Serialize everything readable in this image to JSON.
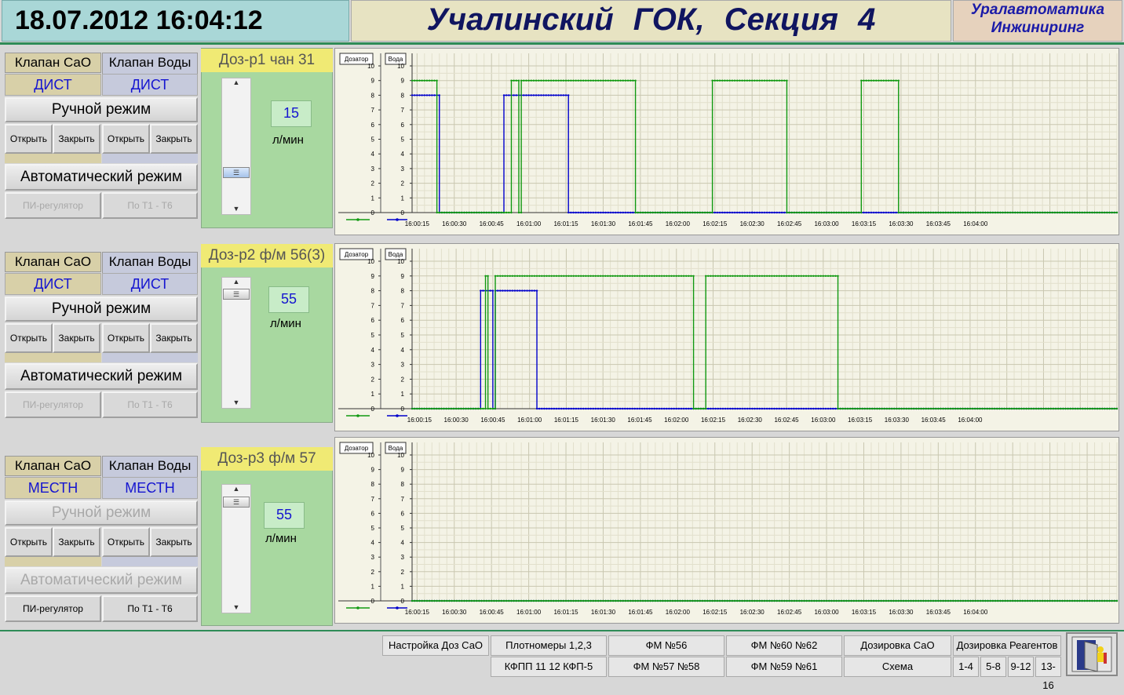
{
  "header": {
    "datetime": "18.07.2012 16:04:12",
    "title": "Учалинский ГОК,    Секция 4",
    "brand_line1": "Уралавтоматика",
    "brand_line2": "Инжиниринг"
  },
  "sections": [
    {
      "cao_label": "Клапан СаО",
      "vod_label": "Клапан Воды",
      "cao_mode": "ДИСТ",
      "vod_mode": "ДИСТ",
      "manual": "Ручной режим",
      "auto": "Автоматический режим",
      "open_cao": "Открыть",
      "close_cao": "Закрыть",
      "open_vod": "Открыть",
      "close_vod": "Закрыть",
      "pi": "ПИ-регулятор",
      "t1t6": "По Т1 - Т6",
      "doser_title": "Доз-р1 чан 31",
      "value": "15",
      "unit": "л/мин",
      "manual_enabled": true,
      "auto_enabled": true,
      "bottom_enabled": false
    },
    {
      "cao_label": "Клапан СаО",
      "vod_label": "Клапан Воды",
      "cao_mode": "ДИСТ",
      "vod_mode": "ДИСТ",
      "manual": "Ручной режим",
      "auto": "Автоматический режим",
      "open_cao": "Открыть",
      "close_cao": "Закрыть",
      "open_vod": "Открыть",
      "close_vod": "Закрыть",
      "pi": "ПИ-регулятор",
      "t1t6": "По Т1 - Т6",
      "doser_title": "Доз-р2  ф/м 56(3)",
      "value": "55",
      "unit": "л/мин",
      "manual_enabled": true,
      "auto_enabled": true,
      "bottom_enabled": false
    },
    {
      "cao_label": "Клапан СаО",
      "vod_label": "Клапан Воды",
      "cao_mode": "МЕСТН",
      "vod_mode": "МЕСТН",
      "manual": "Ручной режим",
      "auto": "Автоматический режим",
      "open_cao": "Открыть",
      "close_cao": "Закрыть",
      "open_vod": "Открыть",
      "close_vod": "Закрыть",
      "pi": "ПИ-регулятор",
      "t1t6": "По Т1 - Т6",
      "doser_title": "Доз-р3 ф/м 57",
      "value": "55",
      "unit": "л/мин",
      "manual_enabled": false,
      "auto_enabled": false,
      "bottom_enabled": true
    }
  ],
  "chart_data": [
    {
      "type": "line",
      "axis_tag_left": "Дозатор",
      "axis_tag_right": "Вода",
      "ylim": [
        0,
        10
      ],
      "yticks": [
        0,
        1,
        2,
        3,
        4,
        5,
        6,
        7,
        8,
        9,
        10
      ],
      "xlim_sec": [
        13,
        297
      ],
      "x_tick_labels": [
        "16:00:15",
        "16:00:30",
        "16:00:45",
        "16:01:00",
        "16:01:15",
        "16:01:30",
        "16:01:45",
        "16:02:00",
        "16:02:15",
        "16:02:30",
        "16:02:45",
        "16:03:00",
        "16:03:15",
        "16:03:30",
        "16:03:45",
        "16:04:00"
      ],
      "x_tick_sec": [
        15,
        30,
        45,
        60,
        75,
        90,
        105,
        120,
        135,
        150,
        165,
        180,
        195,
        210,
        225,
        240
      ],
      "grid": true,
      "series": [
        {
          "color": "#0000cc",
          "points": [
            [
              13,
              8
            ],
            [
              24,
              8
            ],
            [
              24,
              0
            ],
            [
              50,
              0
            ],
            [
              50,
              8
            ],
            [
              76,
              8
            ],
            [
              76,
              0
            ],
            [
              113,
              0
            ],
            [
              113,
              0
            ],
            [
              150,
              0
            ],
            [
              150,
              0
            ],
            [
              180,
              0
            ],
            [
              180,
              0
            ],
            [
              211,
              0
            ],
            [
              211,
              0
            ],
            [
              297,
              0
            ]
          ]
        },
        {
          "color": "#119911",
          "points": [
            [
              13,
              9
            ],
            [
              23,
              9
            ],
            [
              23,
              0
            ],
            [
              53,
              0
            ],
            [
              53,
              9
            ],
            [
              56,
              9
            ],
            [
              56,
              0
            ],
            [
              57,
              0
            ],
            [
              57,
              9
            ],
            [
              103,
              9
            ],
            [
              103,
              0
            ],
            [
              134,
              0
            ],
            [
              134,
              9
            ],
            [
              164,
              9
            ],
            [
              164,
              0
            ],
            [
              194,
              0
            ],
            [
              194,
              9
            ],
            [
              209,
              9
            ],
            [
              209,
              0
            ],
            [
              297,
              0
            ]
          ]
        }
      ]
    },
    {
      "type": "line",
      "axis_tag_left": "Дозатор",
      "axis_tag_right": "Вода",
      "ylim": [
        0,
        10
      ],
      "yticks": [
        0,
        1,
        2,
        3,
        4,
        5,
        6,
        7,
        8,
        9,
        10
      ],
      "xlim_sec": [
        12,
        300
      ],
      "x_tick_labels": [
        "16:00:15",
        "16:00:30",
        "16:00:45",
        "16:01:00",
        "16:01:15",
        "16:01:30",
        "16:01:45",
        "16:02:00",
        "16:02:15",
        "16:02:30",
        "16:02:45",
        "16:03:00",
        "16:03:15",
        "16:03:30",
        "16:03:45",
        "16:04:00"
      ],
      "x_tick_sec": [
        15,
        30,
        45,
        60,
        75,
        90,
        105,
        120,
        135,
        150,
        165,
        180,
        195,
        210,
        225,
        240
      ],
      "grid": true,
      "series": [
        {
          "color": "#0000cc",
          "points": [
            [
              12,
              0
            ],
            [
              40,
              0
            ],
            [
              40,
              8
            ],
            [
              45,
              8
            ],
            [
              45,
              0
            ],
            [
              46,
              0
            ],
            [
              46,
              8
            ],
            [
              63,
              8
            ],
            [
              63,
              0
            ],
            [
              300,
              0
            ]
          ]
        },
        {
          "color": "#119911",
          "points": [
            [
              12,
              0
            ],
            [
              42,
              0
            ],
            [
              42,
              9
            ],
            [
              43,
              9
            ],
            [
              43,
              0
            ],
            [
              46,
              0
            ],
            [
              46,
              9
            ],
            [
              127,
              9
            ],
            [
              127,
              0
            ],
            [
              132,
              0
            ],
            [
              132,
              9
            ],
            [
              186,
              9
            ],
            [
              186,
              0
            ],
            [
              300,
              0
            ]
          ]
        }
      ]
    },
    {
      "type": "line",
      "axis_tag_left": "Дозатор",
      "axis_tag_right": "Вода",
      "ylim": [
        0,
        10
      ],
      "yticks": [
        0,
        1,
        2,
        3,
        4,
        5,
        6,
        7,
        8,
        9,
        10
      ],
      "xlim_sec": [
        13,
        297
      ],
      "x_tick_labels": [
        "16:00:15",
        "16:00:30",
        "16:00:45",
        "16:01:00",
        "16:01:15",
        "16:01:30",
        "16:01:45",
        "16:02:00",
        "16:02:15",
        "16:02:30",
        "16:02:45",
        "16:03:00",
        "16:03:15",
        "16:03:30",
        "16:03:45",
        "16:04:00"
      ],
      "x_tick_sec": [
        15,
        30,
        45,
        60,
        75,
        90,
        105,
        120,
        135,
        150,
        165,
        180,
        195,
        210,
        225,
        240
      ],
      "grid": true,
      "series": [
        {
          "color": "#0000cc",
          "points": [
            [
              13,
              0
            ],
            [
              297,
              0
            ]
          ]
        },
        {
          "color": "#119911",
          "points": [
            [
              13,
              0
            ],
            [
              297,
              0
            ]
          ]
        }
      ]
    }
  ],
  "nav": {
    "row1": [
      "Настройка Доз СаО",
      "Плотномеры 1,2,3",
      "ФМ №56",
      "ФМ №60 №62",
      "Дозировка СаО",
      "Дозировка Реагентов"
    ],
    "row2": [
      "КФПП 11 12 КФП-5",
      "ФМ №57 №58",
      "ФМ №59 №61",
      "Схема"
    ],
    "pages": [
      "1-4",
      "5-8",
      "9-12",
      "13-16"
    ]
  },
  "colors": {
    "accent_green": "#2e8b57",
    "series_water": "#119911",
    "series_doser": "#0000cc",
    "doser_title_bg": "#f0ea74",
    "panel_green": "#a8d8a0"
  }
}
